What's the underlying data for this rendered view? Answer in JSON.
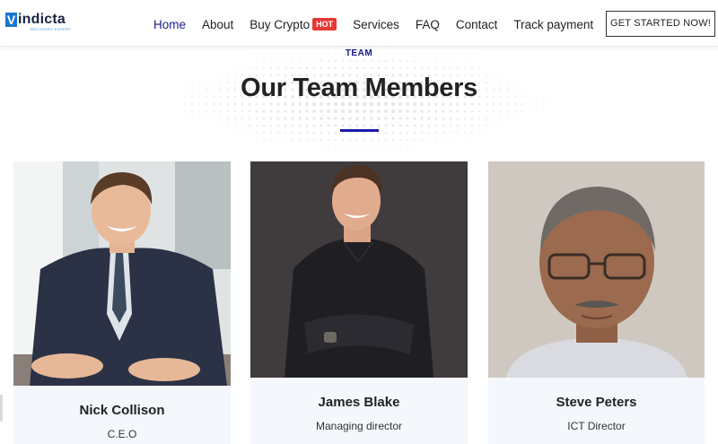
{
  "brand": {
    "letter": "V",
    "word": "indicta",
    "tagline": "RECOVERY EXPERT"
  },
  "nav": {
    "items": [
      "Home",
      "About",
      "Buy Crypto",
      "Services",
      "FAQ",
      "Contact",
      "Track payment"
    ],
    "hot_badge": "HOT",
    "cta": "GET STARTED NOW!"
  },
  "section": {
    "eyebrow": "TEAM",
    "title": "Our Team Members"
  },
  "team": [
    {
      "name": "Nick Collison",
      "role": "C.E.O"
    },
    {
      "name": "James Blake",
      "role": "Managing director"
    },
    {
      "name": "Steve Peters",
      "role": "ICT Director"
    }
  ],
  "colors": {
    "accent": "#1a1a8c",
    "hot": "#e53935",
    "card_bg": "#f4f8fc",
    "logo_blue": "#1976d2"
  }
}
